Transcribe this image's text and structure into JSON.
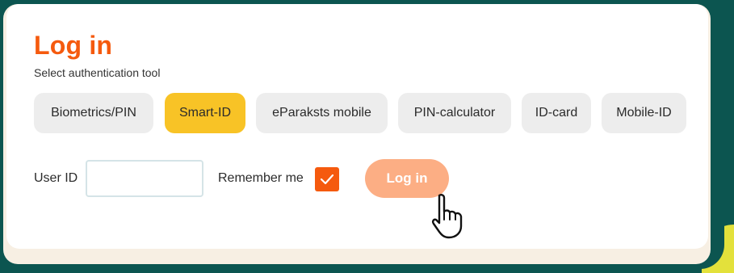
{
  "header": {
    "title": "Log in",
    "subtitle": "Select authentication tool"
  },
  "tabs": [
    {
      "label": "Biometrics/PIN",
      "active": false
    },
    {
      "label": "Smart-ID",
      "active": true
    },
    {
      "label": "eParaksts mobile",
      "active": false
    },
    {
      "label": "PIN-calculator",
      "active": false
    },
    {
      "label": "ID-card",
      "active": false
    },
    {
      "label": "Mobile-ID",
      "active": false
    }
  ],
  "form": {
    "user_id_label": "User ID",
    "user_id_value": "",
    "remember_label": "Remember me",
    "remember_checked": true,
    "login_label": "Log in"
  },
  "icons": {
    "checkbox": "checkmark-icon",
    "cursor": "hand-pointer-icon"
  },
  "colors": {
    "brand": "#f55a0e",
    "active_tab": "#f8c326",
    "login_button": "#fcae84",
    "background": "#0c5550",
    "accent_corner": "#e3e13b"
  }
}
